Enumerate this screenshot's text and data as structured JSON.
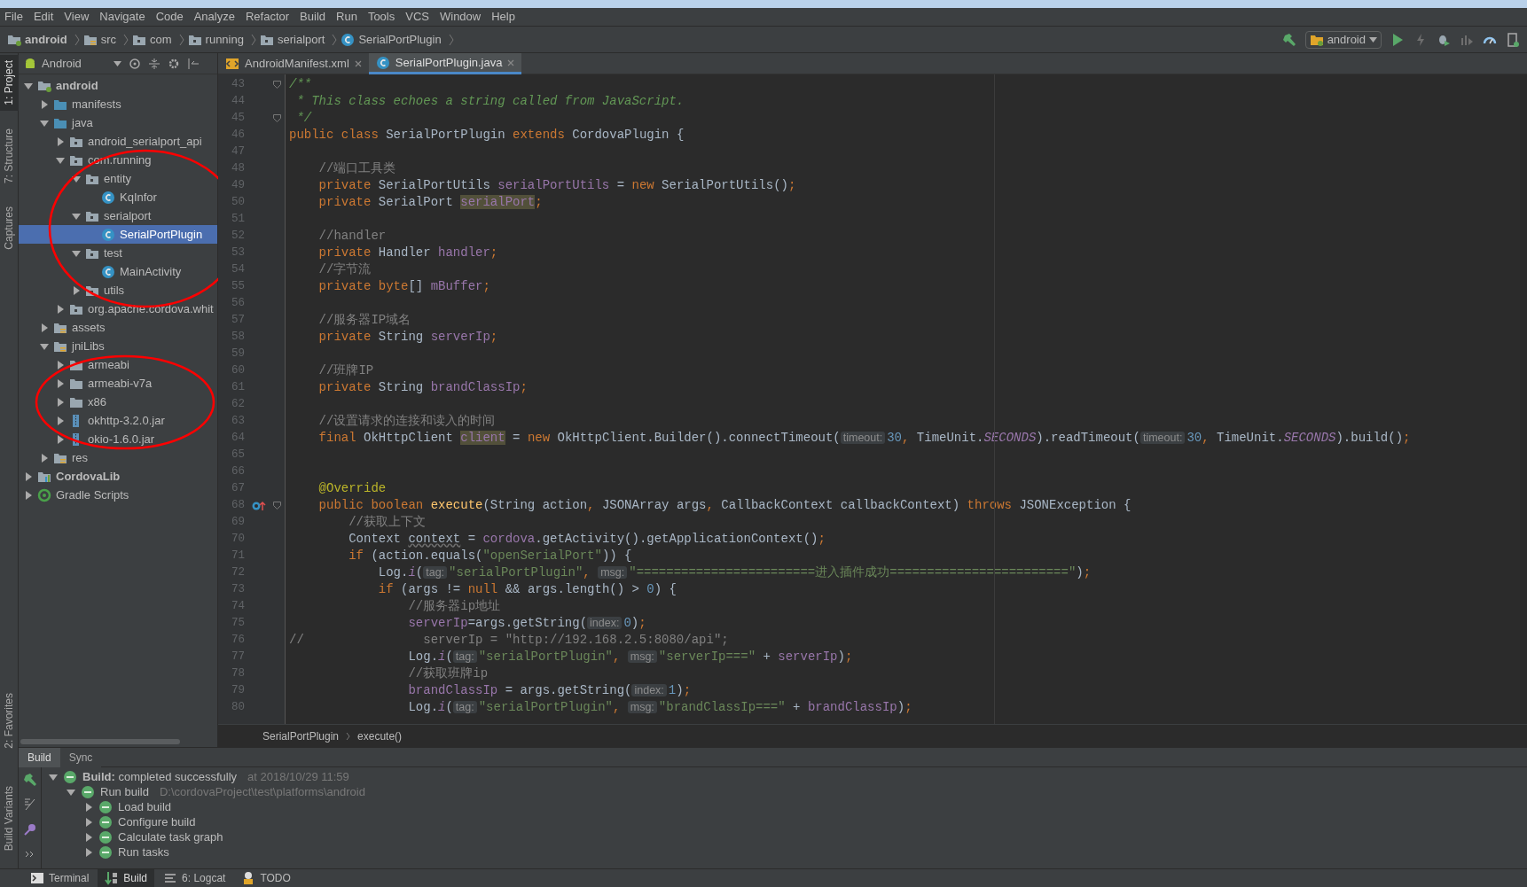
{
  "menu": [
    "File",
    "Edit",
    "View",
    "Navigate",
    "Code",
    "Analyze",
    "Refactor",
    "Build",
    "Run",
    "Tools",
    "VCS",
    "Window",
    "Help"
  ],
  "nav_path": [
    {
      "label": "android",
      "kind": "module"
    },
    {
      "label": "src",
      "kind": "resfolder"
    },
    {
      "label": "com",
      "kind": "package"
    },
    {
      "label": "running",
      "kind": "package"
    },
    {
      "label": "serialport",
      "kind": "package"
    },
    {
      "label": "SerialPortPlugin",
      "kind": "class"
    }
  ],
  "run_config": "android",
  "tool_stripe_top": [
    {
      "label": "1: Project",
      "selected": true
    },
    {
      "label": "7: Structure",
      "selected": false
    },
    {
      "label": "Captures",
      "selected": false
    }
  ],
  "tool_stripe_bottom": [
    {
      "label": "2: Favorites",
      "selected": false
    },
    {
      "label": "Build Variants",
      "selected": false
    }
  ],
  "project_view": {
    "mode": "Android",
    "tree": [
      {
        "label": "android",
        "kind": "module",
        "expanded": true,
        "selected": false,
        "children": [
          {
            "label": "manifests",
            "kind": "folder",
            "expanded": false,
            "selected": false
          },
          {
            "label": "java",
            "kind": "folder",
            "expanded": true,
            "selected": false,
            "children": [
              {
                "label": "android_serialport_api",
                "kind": "package",
                "expanded": false,
                "selected": false
              },
              {
                "label": "com.running",
                "kind": "package",
                "expanded": true,
                "selected": false,
                "children": [
                  {
                    "label": "entity",
                    "kind": "package",
                    "expanded": true,
                    "selected": false,
                    "children": [
                      {
                        "label": "KqInfor",
                        "kind": "class",
                        "selected": false
                      }
                    ]
                  },
                  {
                    "label": "serialport",
                    "kind": "package",
                    "expanded": true,
                    "selected": false,
                    "children": [
                      {
                        "label": "SerialPortPlugin",
                        "kind": "class",
                        "selected": true
                      }
                    ]
                  },
                  {
                    "label": "test",
                    "kind": "package",
                    "expanded": true,
                    "selected": false,
                    "children": [
                      {
                        "label": "MainActivity",
                        "kind": "class",
                        "selected": false
                      }
                    ]
                  },
                  {
                    "label": "utils",
                    "kind": "package",
                    "expanded": false,
                    "selected": false
                  }
                ]
              },
              {
                "label": "org.apache.cordova.whit",
                "kind": "package",
                "expanded": false,
                "selected": false
              }
            ]
          },
          {
            "label": "assets",
            "kind": "resfolder",
            "expanded": false,
            "selected": false
          },
          {
            "label": "jniLibs",
            "kind": "resfolder",
            "expanded": true,
            "selected": false,
            "children": [
              {
                "label": "armeabi",
                "kind": "dir",
                "expanded": false,
                "selected": false
              },
              {
                "label": "armeabi-v7a",
                "kind": "dir",
                "expanded": false,
                "selected": false
              },
              {
                "label": "x86",
                "kind": "dir",
                "expanded": false,
                "selected": false
              },
              {
                "label": "okhttp-3.2.0.jar",
                "kind": "jar",
                "expanded": false,
                "selected": false
              },
              {
                "label": "okio-1.6.0.jar",
                "kind": "jar",
                "expanded": false,
                "selected": false
              }
            ]
          },
          {
            "label": "res",
            "kind": "resfolder",
            "expanded": false,
            "selected": false
          }
        ]
      },
      {
        "label": "CordovaLib",
        "kind": "library",
        "expanded": false,
        "selected": false
      },
      {
        "label": "Gradle Scripts",
        "kind": "gradle",
        "expanded": false,
        "selected": false
      }
    ]
  },
  "annotations": [
    {
      "kind": "ellipse",
      "color": "#ff0000"
    },
    {
      "kind": "ellipse",
      "color": "#ff0000"
    }
  ],
  "editor_tabs": [
    {
      "label": "AndroidManifest.xml",
      "kind": "xml",
      "selected": false
    },
    {
      "label": "SerialPortPlugin.java",
      "kind": "class",
      "selected": true
    }
  ],
  "code_lines": [
    {
      "number": "43",
      "fold": true,
      "segments": [
        {
          "kind": "doc",
          "text": "/**"
        }
      ]
    },
    {
      "number": "44",
      "fold": false,
      "segments": [
        {
          "kind": "doc",
          "text": " * This class echoes a string called from JavaScript."
        }
      ]
    },
    {
      "number": "45",
      "fold": true,
      "segments": [
        {
          "kind": "doc",
          "text": " */"
        }
      ]
    },
    {
      "number": "46",
      "fold": false,
      "segments": [
        {
          "kind": "keyword",
          "text": "public class "
        },
        {
          "kind": "plain",
          "text": "SerialPortPlugin "
        },
        {
          "kind": "keyword",
          "text": "extends "
        },
        {
          "kind": "plain",
          "text": "CordovaPlugin {"
        }
      ]
    },
    {
      "number": "47",
      "fold": false
    },
    {
      "number": "48",
      "fold": false,
      "segments": [
        {
          "kind": "comment",
          "text": "    //端口工具类"
        }
      ]
    },
    {
      "number": "49",
      "fold": false,
      "segments": [
        {
          "kind": "keyword",
          "text": "    private "
        },
        {
          "kind": "plain",
          "text": "SerialPortUtils "
        },
        {
          "kind": "field",
          "text": "serialPortUtils"
        },
        {
          "kind": "plain",
          "text": " = "
        },
        {
          "kind": "keyword",
          "text": "new "
        },
        {
          "kind": "plain",
          "text": "SerialPortUtils()"
        },
        {
          "kind": "keyword",
          "text": ";"
        }
      ]
    },
    {
      "number": "50",
      "fold": false,
      "segments": [
        {
          "kind": "keyword",
          "text": "    private "
        },
        {
          "kind": "plain",
          "text": "SerialPort "
        },
        {
          "kind": "field_marked",
          "text": "serialPort"
        },
        {
          "kind": "keyword",
          "text": ";"
        }
      ]
    },
    {
      "number": "51",
      "fold": false
    },
    {
      "number": "52",
      "fold": false,
      "segments": [
        {
          "kind": "comment",
          "text": "    //handler"
        }
      ]
    },
    {
      "number": "53",
      "fold": false,
      "segments": [
        {
          "kind": "keyword",
          "text": "    private "
        },
        {
          "kind": "plain",
          "text": "Handler "
        },
        {
          "kind": "field",
          "text": "handler"
        },
        {
          "kind": "keyword",
          "text": ";"
        }
      ]
    },
    {
      "number": "54",
      "fold": false,
      "segments": [
        {
          "kind": "comment",
          "text": "    //字节流"
        }
      ]
    },
    {
      "number": "55",
      "fold": false,
      "segments": [
        {
          "kind": "keyword",
          "text": "    private byte"
        },
        {
          "kind": "plain",
          "text": "[] "
        },
        {
          "kind": "field",
          "text": "mBuffer"
        },
        {
          "kind": "keyword",
          "text": ";"
        }
      ]
    },
    {
      "number": "56",
      "fold": false
    },
    {
      "number": "57",
      "fold": false,
      "segments": [
        {
          "kind": "comment",
          "text": "    //服务器IP域名"
        }
      ]
    },
    {
      "number": "58",
      "fold": false,
      "segments": [
        {
          "kind": "keyword",
          "text": "    private "
        },
        {
          "kind": "plain",
          "text": "String "
        },
        {
          "kind": "field",
          "text": "serverIp"
        },
        {
          "kind": "keyword",
          "text": ";"
        }
      ]
    },
    {
      "number": "59",
      "fold": false
    },
    {
      "number": "60",
      "fold": false,
      "segments": [
        {
          "kind": "comment",
          "text": "    //班牌IP"
        }
      ]
    },
    {
      "number": "61",
      "fold": false,
      "segments": [
        {
          "kind": "keyword",
          "text": "    private "
        },
        {
          "kind": "plain",
          "text": "String "
        },
        {
          "kind": "field",
          "text": "brandClassIp"
        },
        {
          "kind": "keyword",
          "text": ";"
        }
      ]
    },
    {
      "number": "62",
      "fold": false
    },
    {
      "number": "63",
      "fold": false,
      "segments": [
        {
          "kind": "comment",
          "text": "    //设置请求的连接和读入的时间"
        }
      ]
    },
    {
      "number": "64",
      "fold": false,
      "segments": [
        {
          "kind": "keyword",
          "text": "    final "
        },
        {
          "kind": "plain",
          "text": "OkHttpClient "
        },
        {
          "kind": "field_marked",
          "text": "client"
        },
        {
          "kind": "plain",
          "text": " = "
        },
        {
          "kind": "keyword",
          "text": "new "
        },
        {
          "kind": "plain",
          "text": "OkHttpClient.Builder().connectTimeout("
        },
        {
          "kind": "hint",
          "text": "timeout:"
        },
        {
          "kind": "number",
          "text": "30"
        },
        {
          "kind": "keyword",
          "text": ", "
        },
        {
          "kind": "plain",
          "text": "TimeUnit."
        },
        {
          "kind": "static",
          "text": "SECONDS"
        },
        {
          "kind": "plain",
          "text": ").readTimeout("
        },
        {
          "kind": "hint",
          "text": "timeout:"
        },
        {
          "kind": "number",
          "text": "30"
        },
        {
          "kind": "keyword",
          "text": ", "
        },
        {
          "kind": "plain",
          "text": "TimeUnit."
        },
        {
          "kind": "static",
          "text": "SECONDS"
        },
        {
          "kind": "plain",
          "text": ").build()"
        },
        {
          "kind": "keyword",
          "text": ";"
        }
      ]
    },
    {
      "number": "65",
      "fold": false
    },
    {
      "number": "66",
      "fold": false
    },
    {
      "number": "67",
      "fold": false,
      "segments": [
        {
          "kind": "annotation",
          "text": "    @Override"
        }
      ]
    },
    {
      "number": "68",
      "fold": true,
      "override": true,
      "segments": [
        {
          "kind": "keyword",
          "text": "    public boolean "
        },
        {
          "kind": "method",
          "text": "execute"
        },
        {
          "kind": "plain",
          "text": "(String action"
        },
        {
          "kind": "keyword",
          "text": ", "
        },
        {
          "kind": "plain",
          "text": "JSONArray args"
        },
        {
          "kind": "keyword",
          "text": ", "
        },
        {
          "kind": "plain",
          "text": "CallbackContext callbackContext) "
        },
        {
          "kind": "keyword",
          "text": "throws "
        },
        {
          "kind": "plain",
          "text": "JSONException {"
        }
      ]
    },
    {
      "number": "69",
      "fold": false,
      "segments": [
        {
          "kind": "comment",
          "text": "        //获取上下文"
        }
      ]
    },
    {
      "number": "70",
      "fold": false,
      "segments": [
        {
          "kind": "plain",
          "text": "        Context "
        },
        {
          "kind": "unused",
          "text": "context"
        },
        {
          "kind": "plain",
          "text": " = "
        },
        {
          "kind": "field",
          "text": "cordova"
        },
        {
          "kind": "plain",
          "text": ".getActivity().getApplicationContext()"
        },
        {
          "kind": "keyword",
          "text": ";"
        }
      ]
    },
    {
      "number": "71",
      "fold": false,
      "segments": [
        {
          "kind": "keyword",
          "text": "        if "
        },
        {
          "kind": "plain",
          "text": "(action.equals("
        },
        {
          "kind": "string",
          "text": "\"openSerialPort\""
        },
        {
          "kind": "plain",
          "text": ")) {"
        }
      ]
    },
    {
      "number": "72",
      "fold": false,
      "segments": [
        {
          "kind": "plain",
          "text": "            Log."
        },
        {
          "kind": "static",
          "text": "i"
        },
        {
          "kind": "plain",
          "text": "("
        },
        {
          "kind": "hint",
          "text": "tag:"
        },
        {
          "kind": "string",
          "text": "\"serialPortPlugin\""
        },
        {
          "kind": "keyword",
          "text": ", "
        },
        {
          "kind": "hint",
          "text": "msg:"
        },
        {
          "kind": "string",
          "text": "\"========================进入插件成功========================\""
        },
        {
          "kind": "plain",
          "text": ")"
        },
        {
          "kind": "keyword",
          "text": ";"
        }
      ]
    },
    {
      "number": "73",
      "fold": false,
      "segments": [
        {
          "kind": "keyword",
          "text": "            if "
        },
        {
          "kind": "plain",
          "text": "(args != "
        },
        {
          "kind": "keyword",
          "text": "null "
        },
        {
          "kind": "plain",
          "text": "&& args.length() > "
        },
        {
          "kind": "number",
          "text": "0"
        },
        {
          "kind": "plain",
          "text": ") {"
        }
      ]
    },
    {
      "number": "74",
      "fold": false,
      "segments": [
        {
          "kind": "comment",
          "text": "                //服务器ip地址"
        }
      ]
    },
    {
      "number": "75",
      "fold": false,
      "segments": [
        {
          "kind": "field",
          "text": "                serverIp"
        },
        {
          "kind": "plain",
          "text": "=args.getString("
        },
        {
          "kind": "hint",
          "text": "index:"
        },
        {
          "kind": "number",
          "text": "0"
        },
        {
          "kind": "plain",
          "text": ")"
        },
        {
          "kind": "keyword",
          "text": ";"
        }
      ]
    },
    {
      "number": "76",
      "fold": false,
      "segments": [
        {
          "kind": "comment",
          "text": "//                serverIp = \"http://192.168.2.5:8080/api\";"
        }
      ]
    },
    {
      "number": "77",
      "fold": false,
      "segments": [
        {
          "kind": "plain",
          "text": "                Log."
        },
        {
          "kind": "static",
          "text": "i"
        },
        {
          "kind": "plain",
          "text": "("
        },
        {
          "kind": "hint",
          "text": "tag:"
        },
        {
          "kind": "string",
          "text": "\"serialPortPlugin\""
        },
        {
          "kind": "keyword",
          "text": ", "
        },
        {
          "kind": "hint",
          "text": "msg:"
        },
        {
          "kind": "string",
          "text": "\"serverIp===\""
        },
        {
          "kind": "plain",
          "text": " + "
        },
        {
          "kind": "field",
          "text": "serverIp"
        },
        {
          "kind": "plain",
          "text": ")"
        },
        {
          "kind": "keyword",
          "text": ";"
        }
      ]
    },
    {
      "number": "78",
      "fold": false,
      "segments": [
        {
          "kind": "comment",
          "text": "                //获取班牌ip"
        }
      ]
    },
    {
      "number": "79",
      "fold": false,
      "segments": [
        {
          "kind": "field",
          "text": "                brandClassIp"
        },
        {
          "kind": "plain",
          "text": " = args.getString("
        },
        {
          "kind": "hint",
          "text": "index:"
        },
        {
          "kind": "number",
          "text": "1"
        },
        {
          "kind": "plain",
          "text": ")"
        },
        {
          "kind": "keyword",
          "text": ";"
        }
      ]
    },
    {
      "number": "80",
      "fold": false,
      "segments": [
        {
          "kind": "plain",
          "text": "                Log."
        },
        {
          "kind": "static",
          "text": "i"
        },
        {
          "kind": "plain",
          "text": "("
        },
        {
          "kind": "hint",
          "text": "tag:"
        },
        {
          "kind": "string",
          "text": "\"serialPortPlugin\""
        },
        {
          "kind": "keyword",
          "text": ", "
        },
        {
          "kind": "hint",
          "text": "msg:"
        },
        {
          "kind": "string",
          "text": "\"brandClassIp===\""
        },
        {
          "kind": "plain",
          "text": " + "
        },
        {
          "kind": "field",
          "text": "brandClassIp"
        },
        {
          "kind": "plain",
          "text": ")"
        },
        {
          "kind": "keyword",
          "text": ";"
        }
      ]
    }
  ],
  "editor_breadcrumb": [
    "SerialPortPlugin",
    "execute()"
  ],
  "build_panel": {
    "tabs": [
      {
        "label": "Build",
        "selected": true
      },
      {
        "label": "Sync",
        "selected": false
      }
    ],
    "tree": [
      {
        "label": "**Build:** completed successfully",
        "detail": "at 2018/10/29 11:59",
        "expanded": true,
        "children": [
          {
            "label": "Run build",
            "detail": "D:\\cordovaProject\\test\\platforms\\android",
            "expanded": true,
            "children": [
              {
                "label": "Load build",
                "expanded": false
              },
              {
                "label": "Configure build",
                "expanded": false
              },
              {
                "label": "Calculate task graph",
                "expanded": false
              },
              {
                "label": "Run tasks",
                "expanded": false
              }
            ]
          }
        ]
      }
    ]
  },
  "bottom_tabs": [
    {
      "label": "Terminal",
      "kind": "terminal",
      "selected": false
    },
    {
      "label": "Build",
      "kind": "build",
      "selected": true
    },
    {
      "label": "6: Logcat",
      "kind": "logcat",
      "selected": false
    },
    {
      "label": "TODO",
      "kind": "todo",
      "selected": false
    }
  ]
}
